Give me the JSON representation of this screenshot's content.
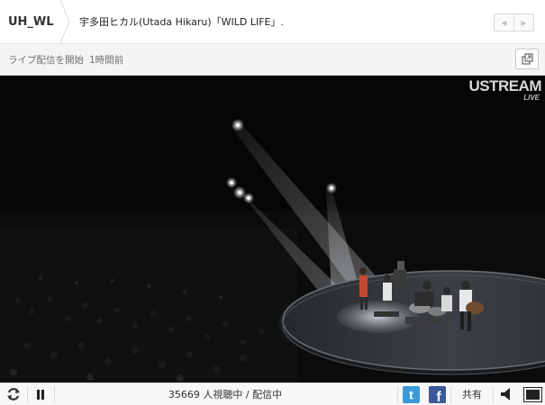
{
  "header": {
    "channel": "UH_WL",
    "title": "宇多田ヒカル(Utada Hikaru)「WILD LIFE」."
  },
  "subbar": {
    "status": "ライブ配信を開始",
    "time": "1時間前"
  },
  "video": {
    "logo_brand": "USTREAM",
    "logo_live": "LIVE"
  },
  "controls": {
    "viewers": "35669 人視聴中 / 配信中",
    "share_label": "共有",
    "icons": [
      "refresh-icon",
      "pause-icon",
      "twitter-icon",
      "facebook-icon",
      "volume-icon",
      "fullscreen-icon"
    ]
  },
  "colors": {
    "twitter": "#3a9ad9",
    "facebook": "#3b5998"
  }
}
